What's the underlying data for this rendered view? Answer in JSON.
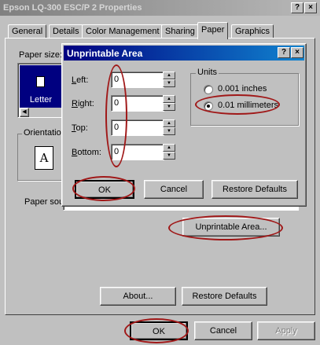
{
  "window": {
    "title": "Epson LQ-300 ESC/P 2 Properties",
    "help_label": "?",
    "close_label": "×"
  },
  "tabs": [
    "General",
    "Details",
    "Color Management",
    "Sharing",
    "Paper",
    "Graphics"
  ],
  "active_tab": "Paper",
  "paper_tab": {
    "paper_size_label": "Paper size:",
    "paper_item_label": "Letter",
    "orientation_label": "Orientatio",
    "orientation_icon_letter": "A",
    "paper_source_label": "Paper sou",
    "unprintable_area_button": "Unprintable Area...",
    "about_button": "About...",
    "restore_defaults_button": "Restore Defaults"
  },
  "footer": {
    "ok_label": "OK",
    "cancel_label": "Cancel",
    "apply_label": "Apply"
  },
  "dialog": {
    "title": "Unprintable Area",
    "help_label": "?",
    "close_label": "×",
    "fields": [
      {
        "label": "Left:",
        "value": "0"
      },
      {
        "label": "Right:",
        "value": "0"
      },
      {
        "label": "Top:",
        "value": "0"
      },
      {
        "label": "Bottom:",
        "value": "0"
      }
    ],
    "units_label": "Units",
    "units_options": [
      "0.001 inches",
      "0.01 millimeters"
    ],
    "units_selected": "0.01 millimeters",
    "ok_label": "OK",
    "cancel_label": "Cancel",
    "restore_defaults_label": "Restore Defaults"
  },
  "colors": {
    "annotation": "#a01818",
    "dialog_title_bg": "#000080",
    "face": "#c0c0c0"
  }
}
